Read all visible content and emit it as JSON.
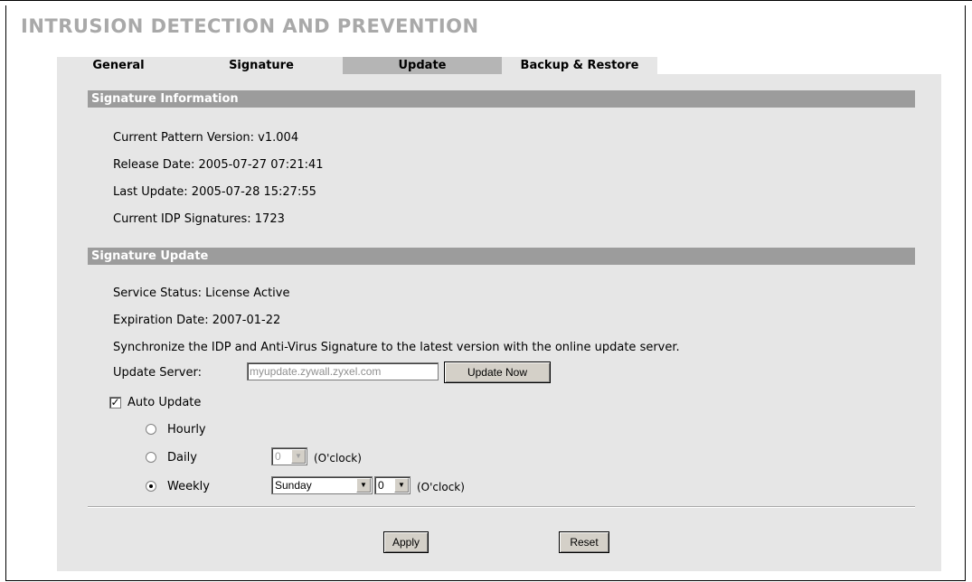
{
  "page": {
    "title": "INTRUSION DETECTION AND PREVENTION"
  },
  "tabs": [
    {
      "label": "General",
      "active": false
    },
    {
      "label": "Signature",
      "active": false
    },
    {
      "label": "Update",
      "active": true
    },
    {
      "label": "Backup & Restore",
      "active": false
    }
  ],
  "signature_info": {
    "header": "Signature Information",
    "current_pattern_version": "Current Pattern Version: v1.004",
    "release_date": "Release Date: 2005-07-27 07:21:41",
    "last_update": "Last Update: 2005-07-28 15:27:55",
    "current_signatures": "Current IDP Signatures: 1723"
  },
  "signature_update": {
    "header": "Signature Update",
    "service_status": "Service Status: License Active",
    "expiration_date": "Expiration Date: 2007-01-22",
    "sync_text": "Synchronize the IDP and Anti-Virus Signature to the latest version with the online update server.",
    "server_label": "Update Server:",
    "server_value": "myupdate.zywall.zyxel.com",
    "update_now_label": "Update Now",
    "auto_update_label": "Auto Update",
    "auto_update_checked": true,
    "hourly_label": "Hourly",
    "daily_label": "Daily",
    "daily_hour": "0",
    "weekly_label": "Weekly",
    "weekly_day": "Sunday",
    "weekly_hour": "0",
    "oclock_label": "(O'clock)",
    "selected_frequency": "Weekly"
  },
  "actions": {
    "apply_label": "Apply",
    "reset_label": "Reset"
  },
  "icons": {
    "dropdown": "chevron-down-icon",
    "check": "check-icon"
  },
  "colors": {
    "section_bar": "#9c9c9c",
    "panel_bg": "#e6e6e6",
    "active_tab": "#b5b5b5",
    "title": "#a9a9a9"
  }
}
